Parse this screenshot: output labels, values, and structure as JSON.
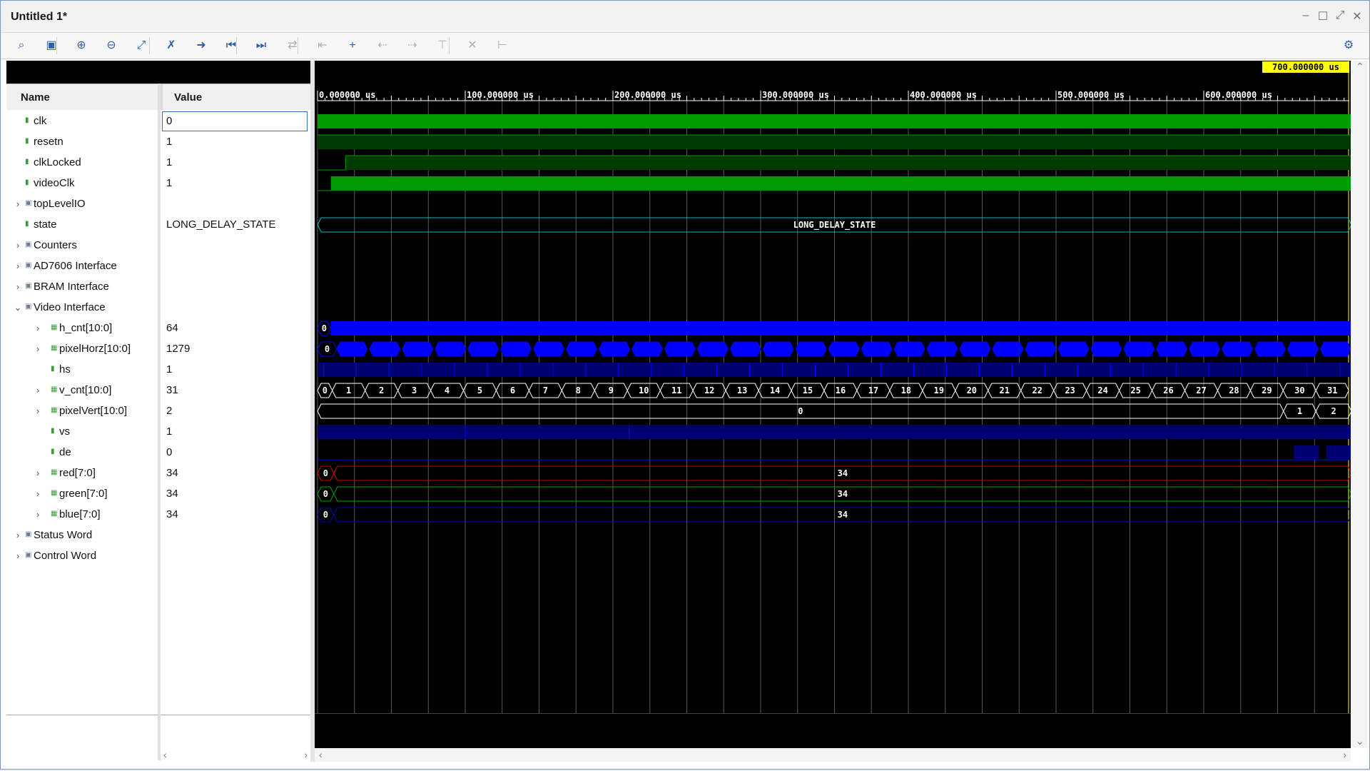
{
  "window": {
    "title": "Untitled 1*"
  },
  "toolbar": {
    "buttons": [
      {
        "icon": "search-icon",
        "glyph": "⌕",
        "enabled": true
      },
      {
        "icon": "save-icon",
        "glyph": "▣",
        "enabled": true
      },
      {
        "icon": "zoom-in-icon",
        "glyph": "⊕",
        "enabled": true
      },
      {
        "icon": "zoom-out-icon",
        "glyph": "⊖",
        "enabled": true
      },
      {
        "icon": "zoom-fit-icon",
        "glyph": "⤢",
        "enabled": true
      },
      {
        "icon": "cursor-to-zero-icon",
        "glyph": "✗",
        "enabled": true
      },
      {
        "icon": "cursor-to-marker-icon",
        "glyph": "➜",
        "enabled": true
      },
      {
        "icon": "go-to-start-icon",
        "glyph": "⏮",
        "enabled": true
      },
      {
        "icon": "go-to-end-icon",
        "glyph": "⏭",
        "enabled": true
      },
      {
        "icon": "swap-cursors-icon",
        "glyph": "⇄",
        "enabled": false
      },
      {
        "icon": "previous-transition-icon",
        "glyph": "⇤",
        "enabled": false
      },
      {
        "icon": "add-marker-icon",
        "glyph": "+",
        "enabled": true
      },
      {
        "icon": "previous-marker-icon",
        "glyph": "⇠",
        "enabled": false
      },
      {
        "icon": "next-marker-icon",
        "glyph": "⇢",
        "enabled": false
      },
      {
        "icon": "snap-marker-icon",
        "glyph": "⊤",
        "enabled": false
      },
      {
        "icon": "delete-marker-icon",
        "glyph": "✕",
        "enabled": false
      },
      {
        "icon": "marker-range-icon",
        "glyph": "⊢",
        "enabled": false
      }
    ],
    "settings_icon": "gear-icon"
  },
  "columns": {
    "name": "Name",
    "value": "Value"
  },
  "signals": [
    {
      "name": "clk",
      "value": "0",
      "kind": "sig",
      "indent": 0
    },
    {
      "name": "resetn",
      "value": "1",
      "kind": "sig",
      "indent": 0
    },
    {
      "name": "clkLocked",
      "value": "1",
      "kind": "sig",
      "indent": 0
    },
    {
      "name": "videoClk",
      "value": "1",
      "kind": "sig",
      "indent": 0
    },
    {
      "name": "topLevelIO",
      "value": "",
      "kind": "grp",
      "indent": 0,
      "collapsed": true
    },
    {
      "name": "state",
      "value": "LONG_DELAY_STATE",
      "kind": "sig",
      "indent": 0
    },
    {
      "name": "Counters",
      "value": "",
      "kind": "grp",
      "indent": 0,
      "collapsed": true
    },
    {
      "name": "AD7606 Interface",
      "value": "",
      "kind": "grp",
      "indent": 0,
      "collapsed": true
    },
    {
      "name": "BRAM Interface",
      "value": "",
      "kind": "grp",
      "indent": 0,
      "collapsed": true
    },
    {
      "name": "Video Interface",
      "value": "",
      "kind": "grp",
      "indent": 0,
      "collapsed": false
    },
    {
      "name": "h_cnt[10:0]",
      "value": "64",
      "kind": "bus",
      "indent": 1,
      "collapsed": true
    },
    {
      "name": "pixelHorz[10:0]",
      "value": "1279",
      "kind": "bus",
      "indent": 1,
      "collapsed": true
    },
    {
      "name": "hs",
      "value": "1",
      "kind": "sig",
      "indent": 1
    },
    {
      "name": "v_cnt[10:0]",
      "value": "31",
      "kind": "bus",
      "indent": 1,
      "collapsed": true
    },
    {
      "name": "pixelVert[10:0]",
      "value": "2",
      "kind": "bus",
      "indent": 1,
      "collapsed": true
    },
    {
      "name": "vs",
      "value": "1",
      "kind": "sig",
      "indent": 1
    },
    {
      "name": "de",
      "value": "0",
      "kind": "sig",
      "indent": 1
    },
    {
      "name": "red[7:0]",
      "value": "34",
      "kind": "bus",
      "indent": 1,
      "collapsed": true
    },
    {
      "name": "green[7:0]",
      "value": "34",
      "kind": "bus",
      "indent": 1,
      "collapsed": true
    },
    {
      "name": "blue[7:0]",
      "value": "34",
      "kind": "bus",
      "indent": 1,
      "collapsed": true
    },
    {
      "name": "Status Word",
      "value": "",
      "kind": "grp",
      "indent": 0,
      "collapsed": true
    },
    {
      "name": "Control Word",
      "value": "",
      "kind": "grp",
      "indent": 0,
      "collapsed": true
    }
  ],
  "timeline": {
    "unit": "us",
    "ticks": [
      "0.000000 us",
      "100.000000 us",
      "200.000000 us",
      "300.000000 us",
      "400.000000 us",
      "500.000000 us",
      "600.000000 us"
    ],
    "tick_times_us": [
      0,
      100,
      200,
      300,
      400,
      500,
      600
    ],
    "view_end_us": 700,
    "cursor_label": "700.000000 us"
  },
  "waves": {
    "state_label": "LONG_DELAY_STATE",
    "h_cnt_initial": "0",
    "pixelHorz_initial": "0",
    "v_cnt_values": [
      "0",
      "1",
      "2",
      "3",
      "4",
      "5",
      "6",
      "7",
      "8",
      "9",
      "10",
      "11",
      "12",
      "13",
      "14",
      "15",
      "16",
      "17",
      "18",
      "19",
      "20",
      "21",
      "22",
      "23",
      "24",
      "25",
      "26",
      "27",
      "28",
      "29",
      "30",
      "31"
    ],
    "pixelVert_values": [
      "0",
      "1",
      "2"
    ],
    "red": {
      "initial": "0",
      "value": "34"
    },
    "green": {
      "initial": "0",
      "value": "34"
    },
    "blue": {
      "initial": "0",
      "value": "34"
    },
    "colors": {
      "clk": "#009900",
      "dim_green": "#003c00",
      "bus_blue": "#0000ff",
      "dim_blue": "#00006e",
      "state_cyan": "#00c0c0",
      "red": "#d00000",
      "green": "#00a000",
      "blue": "#0000c0",
      "grid": "#5a5a5a"
    }
  }
}
